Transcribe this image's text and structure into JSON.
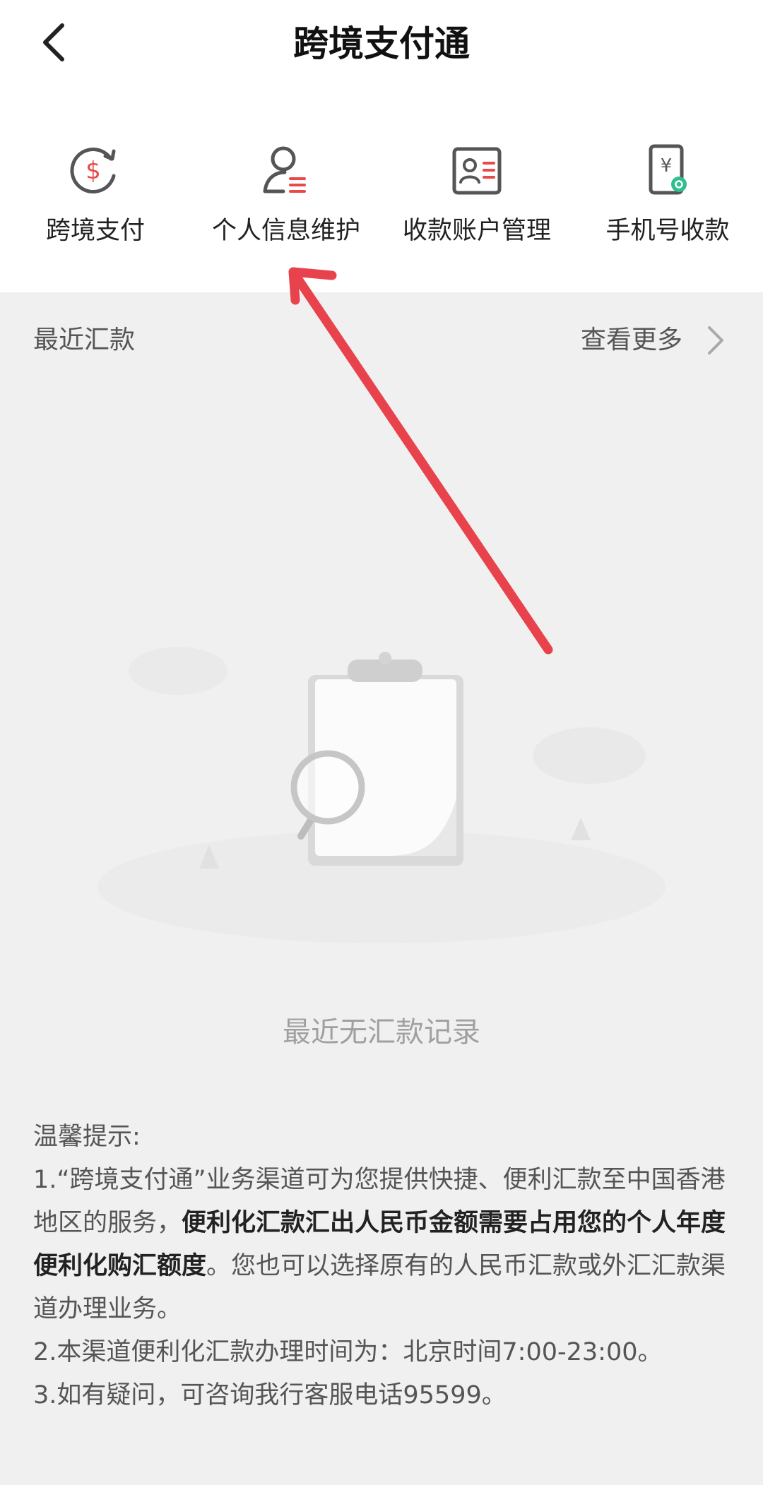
{
  "header": {
    "title": "跨境支付通"
  },
  "menu": [
    {
      "label": "跨境支付",
      "icon": "dollar-refresh-icon"
    },
    {
      "label": "个人信息维护",
      "icon": "user-info-icon"
    },
    {
      "label": "收款账户管理",
      "icon": "id-card-icon"
    },
    {
      "label": "手机号收款",
      "icon": "phone-yuan-icon"
    }
  ],
  "recent": {
    "title": "最近汇款",
    "more_label": "查看更多",
    "empty_text": "最近无汇款记录"
  },
  "tips": {
    "heading": "温馨提示:",
    "item1_prefix": "1.“跨境支付通”业务渠道可为您提供快捷、便利汇款至中国香港地区的服务，",
    "item1_bold": "便利化汇款汇出人民币金额需要占用您的个人年度便利化购汇额度",
    "item1_suffix": "。您也可以选择原有的人民币汇款或外汇汇款渠道办理业务。",
    "item2": "2.本渠道便利化汇款办理时间为：北京时间7:00-23:00。",
    "item3": "3.如有疑问，可咨询我行客服电话95599。"
  },
  "colors": {
    "accent_red": "#e84a4a",
    "icon_gray": "#555555",
    "icon_green": "#2fbf8f",
    "annotation_arrow": "#e8424c"
  }
}
